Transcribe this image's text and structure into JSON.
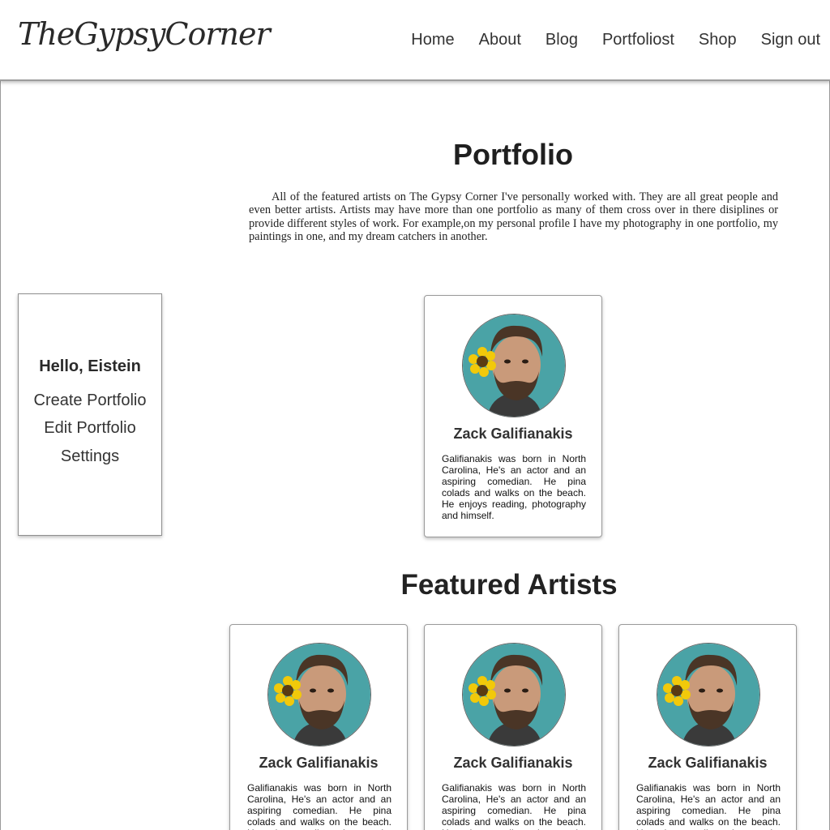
{
  "header": {
    "logo": "TheGypsyCorner",
    "nav": [
      "Home",
      "About",
      "Blog",
      "Portfoliost",
      "Shop",
      "Sign out"
    ]
  },
  "main": {
    "title": "Portfolio",
    "intro": "All of the featured artists on The Gypsy Corner I've personally worked with. They are all great people and even better artists. Artists may have more than one portfolio as many of them cross over in there disiplines or provide different styles of work. For example,on my personal profile I have my photography in one portfolio, my paintings in one, and my dream catchers in another."
  },
  "sidebar": {
    "greeting": "Hello, Eistein",
    "links": [
      "Create Portfolio",
      "Edit Portfolio",
      "Settings"
    ]
  },
  "profile_card": {
    "name": "Zack Galifianakis",
    "bio": "Galifianakis was born in North Carolina, He's an actor and an aspiring comedian. He pina colads and walks on the beach. He enjoys reading, photography and himself."
  },
  "featured": {
    "title": "Featured Artists",
    "artists": [
      {
        "name": "Zack Galifianakis",
        "bio": "Galifianakis was born in North Carolina, He's an actor and an aspiring comedian. He pina colads and walks on the beach. He enjoys reading, photography and himself."
      },
      {
        "name": "Zack Galifianakis",
        "bio": "Galifianakis was born in North Carolina, He's an actor and an aspiring comedian. He pina colads and walks on the beach. He enjoys reading, photography and himself."
      },
      {
        "name": "Zack Galifianakis",
        "bio": "Galifianakis was born in North Carolina, He's an actor and an aspiring comedian. He pina colads and walks on the beach. He enjoys reading, photography and himself."
      }
    ]
  },
  "colors": {
    "avatar_background": "#4aa3a6",
    "flower_petals": "#f2c90a",
    "border": "#9a9a9a"
  }
}
